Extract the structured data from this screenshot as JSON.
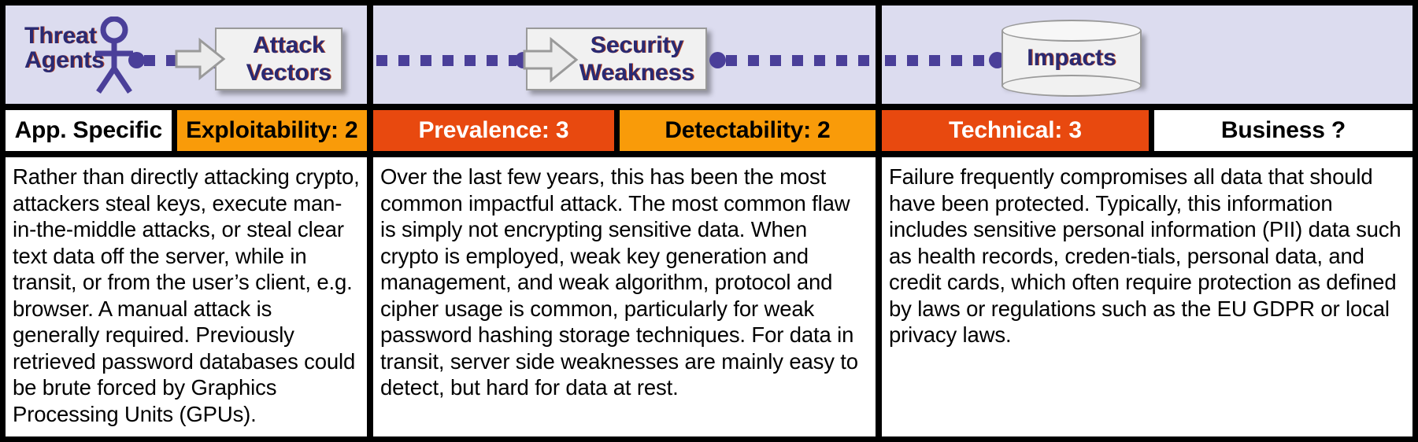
{
  "diagram": {
    "title": "OWASP Risk Rating Diagram",
    "colors": {
      "band_background": "#dcdcef",
      "orange": "#f99b09",
      "red": "#e8490f",
      "white": "#ffffff",
      "accent_purple": "#4a3f99",
      "label_navy": "#2a2a72"
    }
  },
  "flow": {
    "threat_agents_label": "Threat\nAgents",
    "attack_vectors_label": "Attack\nVectors",
    "security_weakness_label": "Security\nWeakness",
    "impacts_label": "Impacts",
    "icons": {
      "actor": "stick-figure-icon",
      "arrow": "block-arrow-icon",
      "database": "cylinder-database-icon",
      "connector": "dotted-line-connector"
    }
  },
  "ratings": {
    "columns": [
      {
        "cells": [
          {
            "label": "App. Specific",
            "style": "white"
          },
          {
            "label": "Exploitability: 2",
            "style": "orange"
          }
        ]
      },
      {
        "cells": [
          {
            "label": "Prevalence: 3",
            "style": "red"
          },
          {
            "label": "Detectability: 2",
            "style": "orange"
          }
        ]
      },
      {
        "cells": [
          {
            "label": "Technical: 3",
            "style": "red"
          },
          {
            "label": "Business ?",
            "style": "white"
          }
        ]
      }
    ]
  },
  "descriptions": {
    "left": "Rather than directly attacking crypto, attackers steal keys, execute man-in-the-middle attacks, or steal clear text data off the server, while in transit, or from the user’s client, e.g. browser. A manual attack is generally required. Previously retrieved password databases could be brute forced by Graphics Processing Units (GPUs).",
    "middle": "Over the last few years, this has been the most common impactful attack. The most common flaw is simply not encrypting sensitive data. When crypto is employed, weak key generation and management, and weak algorithm, protocol and cipher usage is common, particularly for weak password hashing storage techniques. For data in transit, server side weaknesses are mainly easy to detect, but hard for data at rest.",
    "right": "Failure frequently compromises all data that should have been protected. Typically, this information includes sensitive personal information (PII) data such as health records, creden-tials, personal data, and credit cards, which often require protection as defined by laws or regulations such as the EU GDPR or local privacy laws."
  }
}
